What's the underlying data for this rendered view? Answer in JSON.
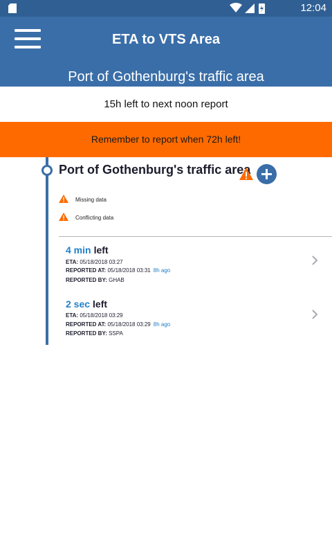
{
  "status_bar": {
    "time": "12:04",
    "icons": [
      "sd-card-icon",
      "wifi-icon",
      "cellular-signal-icon",
      "battery-charging-icon"
    ]
  },
  "appbar": {
    "title": "ETA to VTS Area",
    "subtitle": "Port of Gothenburg's traffic area"
  },
  "noon_report_text": "15h left to next noon report",
  "banner_text": "Remember to report when 72h left!",
  "area": {
    "title": "Port of Gothenburg's traffic area",
    "warnings": [
      "Missing data",
      "Conflicting data"
    ]
  },
  "reports": [
    {
      "time_value": "4 min",
      "time_suffix": "left",
      "eta_label": "ETA:",
      "eta": "05/18/2018 03:27",
      "reported_at_label": "REPORTED AT:",
      "reported_at": "05/18/2018 03:31",
      "ago": "8h ago",
      "reported_by_label": "REPORTED BY:",
      "reported_by": "GHAB"
    },
    {
      "time_value": "2 sec",
      "time_suffix": "left",
      "eta_label": "ETA:",
      "eta": "05/18/2018 03:29",
      "reported_at_label": "REPORTED AT:",
      "reported_at": "05/18/2018 03:29",
      "ago": "8h ago",
      "reported_by_label": "REPORTED BY:",
      "reported_by": "SSPA"
    }
  ],
  "colors": {
    "primary": "#3a6ea8",
    "status_bar": "#2f5f93",
    "banner": "#ff6a00",
    "accent_text": "#2280c8",
    "warning": "#ff6a00"
  }
}
